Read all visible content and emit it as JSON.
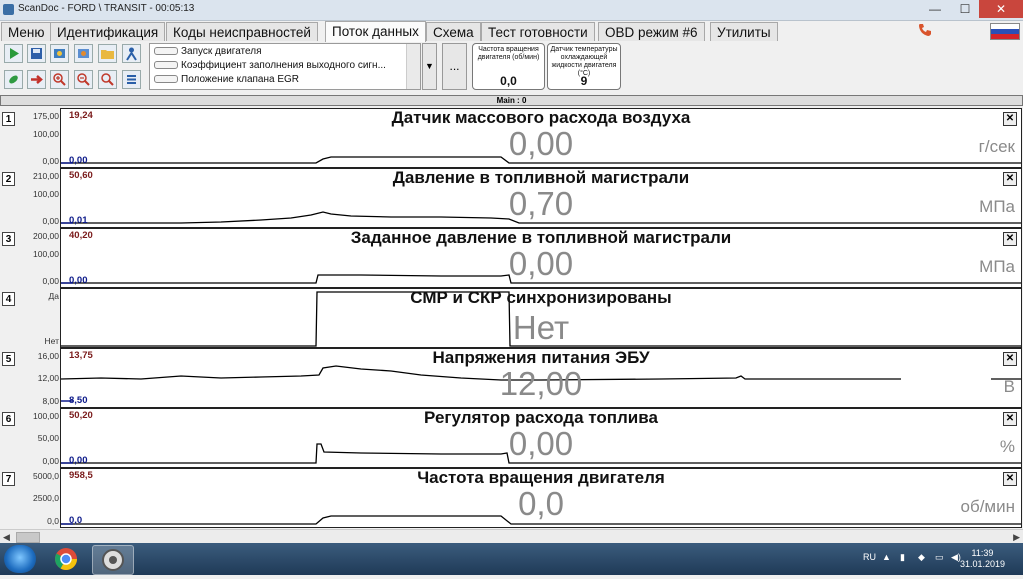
{
  "window": {
    "title": "ScanDoc - FORD \\ TRANSIT - 00:05:13",
    "minimize": "—",
    "maximize": "☐",
    "close": "✕"
  },
  "menu": {
    "tabs": [
      "Меню",
      "Идентификация",
      "Коды неисправностей",
      "Поток данных",
      "Схема",
      "Тест готовности",
      "OBD режим #6",
      "Утилиты"
    ],
    "active_tab": "Поток данных"
  },
  "toolbar": {
    "params": [
      "Запуск двигателя",
      "Коэффициент заполнения выходного сигн...",
      "Положение клапана EGR"
    ],
    "more_label": "...",
    "dropdown": "▼"
  },
  "gauges": [
    {
      "label": "Частота вращения двигателя (об/мин)",
      "value": "0,0"
    },
    {
      "label": "Датчик температуры охлаждающей жидкости двигателя (°C)",
      "value": "9"
    }
  ],
  "main_label": "Main : 0",
  "panels": [
    {
      "num": "1",
      "title": "Датчик массового расхода воздуха",
      "value": "0,00",
      "unit": "г/сек",
      "scale_top": "175,00",
      "scale_mid": "100,00",
      "scale_bot": "0,00",
      "max": "19,24",
      "min": "0,00"
    },
    {
      "num": "2",
      "title": "Давление в топливной магистрали",
      "value": "0,70",
      "unit": "МПа",
      "scale_top": "210,00",
      "scale_mid": "100,00",
      "scale_bot": "0,00",
      "max": "50,60",
      "min": "0,01"
    },
    {
      "num": "3",
      "title": "Заданное давление в топливной магистрали",
      "value": "0,00",
      "unit": "МПа",
      "scale_top": "200,00",
      "scale_mid": "100,00",
      "scale_bot": "0,00",
      "max": "40,20",
      "min": "0,00"
    },
    {
      "num": "4",
      "title": "СМР и СКР синхронизированы",
      "value": "Нет",
      "unit": "",
      "scale_top": "Да",
      "scale_mid": "",
      "scale_bot": "Нет",
      "max": "",
      "min": ""
    },
    {
      "num": "5",
      "title": "Напряжения питания ЭБУ",
      "value": "12,00",
      "unit": "В",
      "scale_top": "16,00",
      "scale_mid": "12,00",
      "scale_bot": "8,00",
      "max": "13,75",
      "min": "8,50"
    },
    {
      "num": "6",
      "title": "Регулятор расхода топлива",
      "value": "0,00",
      "unit": "%",
      "scale_top": "100,00",
      "scale_mid": "50,00",
      "scale_bot": "0,00",
      "max": "50,20",
      "min": "0,00"
    },
    {
      "num": "7",
      "title": "Частота вращения двигателя",
      "value": "0,0",
      "unit": "об/мин",
      "scale_top": "5000,0",
      "scale_mid": "2500,0",
      "scale_bot": "0,0",
      "max": "958,5",
      "min": "0,0"
    }
  ],
  "panel_close": "✕",
  "taskbar": {
    "lang": "RU",
    "time": "11:39",
    "date": "31.01.2019"
  }
}
